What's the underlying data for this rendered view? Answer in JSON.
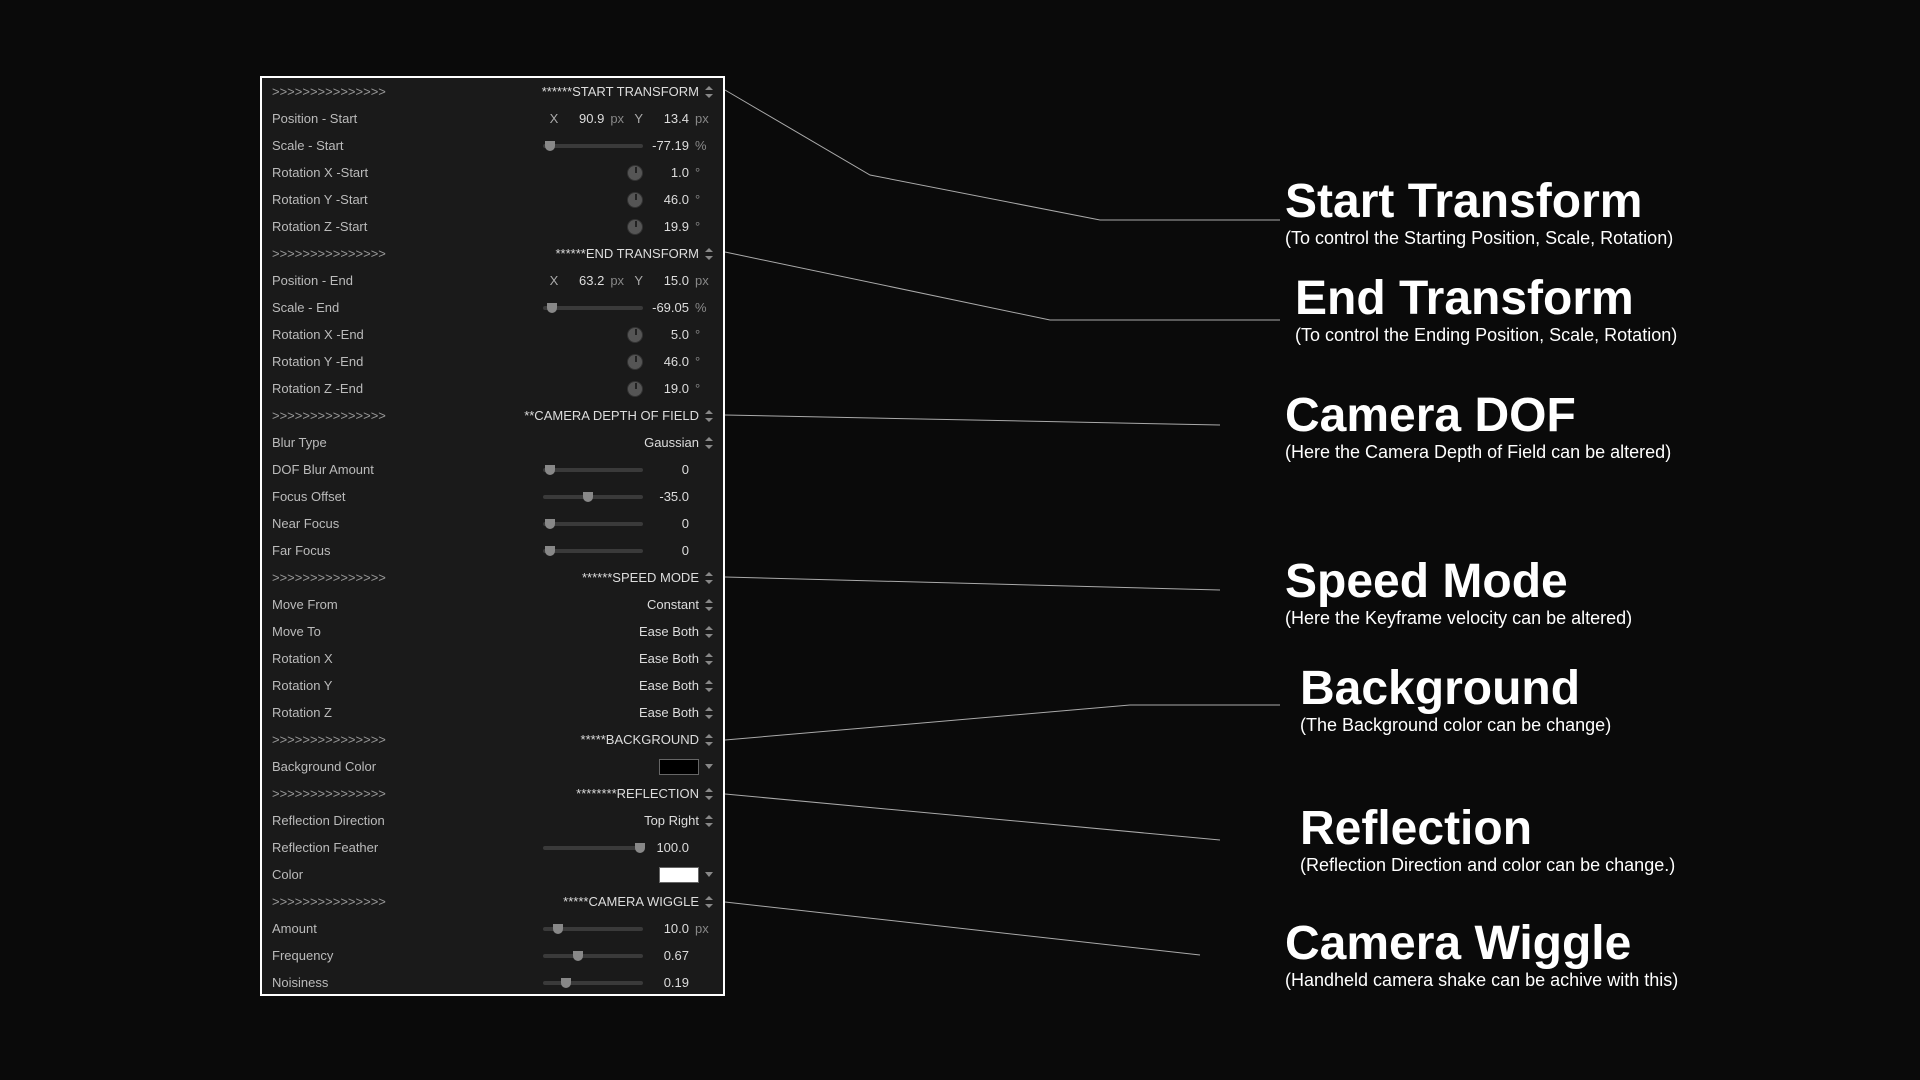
{
  "sections": {
    "start_transform": {
      "header_prefix": ">>>>>>>>>>>>>>>",
      "header": "******START TRANSFORM"
    },
    "end_transform": {
      "header_prefix": ">>>>>>>>>>>>>>>",
      "header": "******END TRANSFORM"
    },
    "dof": {
      "header_prefix": ">>>>>>>>>>>>>>>",
      "header": "**CAMERA DEPTH OF FIELD"
    },
    "speed": {
      "header_prefix": ">>>>>>>>>>>>>>>",
      "header": "******SPEED MODE"
    },
    "background": {
      "header_prefix": ">>>>>>>>>>>>>>>",
      "header": "*****BACKGROUND"
    },
    "reflection": {
      "header_prefix": ">>>>>>>>>>>>>>>",
      "header": "********REFLECTION"
    },
    "wiggle": {
      "header_prefix": ">>>>>>>>>>>>>>>",
      "header": "*****CAMERA WIGGLE"
    }
  },
  "start": {
    "position_label": "Position - Start",
    "x_axis": "X",
    "x_value": "90.9",
    "x_unit": "px",
    "y_axis": "Y",
    "y_value": "13.4",
    "y_unit": "px",
    "scale_label": "Scale - Start",
    "scale_value": "-77.19",
    "scale_unit": "%",
    "rotx_label": "Rotation X -Start",
    "rotx_value": "1.0",
    "rotx_unit": "°",
    "roty_label": "Rotation Y -Start",
    "roty_value": "46.0",
    "roty_unit": "°",
    "rotz_label": "Rotation Z -Start",
    "rotz_value": "19.9",
    "rotz_unit": "°"
  },
  "end": {
    "position_label": "Position - End",
    "x_axis": "X",
    "x_value": "63.2",
    "x_unit": "px",
    "y_axis": "Y",
    "y_value": "15.0",
    "y_unit": "px",
    "scale_label": "Scale - End",
    "scale_value": "-69.05",
    "scale_unit": "%",
    "rotx_label": "Rotation X -End",
    "rotx_value": "5.0",
    "rotx_unit": "°",
    "roty_label": "Rotation Y -End",
    "roty_value": "46.0",
    "roty_unit": "°",
    "rotz_label": "Rotation Z -End",
    "rotz_value": "19.0",
    "rotz_unit": "°"
  },
  "dof": {
    "blur_type_label": "Blur Type",
    "blur_type_value": "Gaussian",
    "blur_amount_label": "DOF Blur Amount",
    "blur_amount_value": "0",
    "focus_offset_label": "Focus Offset",
    "focus_offset_value": "-35.0",
    "near_focus_label": "Near Focus",
    "near_focus_value": "0",
    "far_focus_label": "Far Focus",
    "far_focus_value": "0"
  },
  "speed": {
    "move_from_label": "Move From",
    "move_from_value": "Constant",
    "move_to_label": "Move To",
    "move_to_value": "Ease Both",
    "rotx_label": "Rotation X",
    "rotx_value": "Ease Both",
    "roty_label": "Rotation Y",
    "roty_value": "Ease Both",
    "rotz_label": "Rotation Z",
    "rotz_value": "Ease Both"
  },
  "background": {
    "color_label": "Background Color",
    "color_value": "#000000"
  },
  "reflection": {
    "direction_label": "Reflection Direction",
    "direction_value": "Top Right",
    "feather_label": "Reflection Feather",
    "feather_value": "100.0",
    "color_label": "Color",
    "color_value": "#ffffff"
  },
  "wiggle": {
    "amount_label": "Amount",
    "amount_value": "10.0",
    "amount_unit": "px",
    "frequency_label": "Frequency",
    "frequency_value": "0.67",
    "noisiness_label": "Noisiness",
    "noisiness_value": "0.19"
  },
  "callouts": {
    "start": {
      "title": "Start Transform",
      "sub": "(To control the Starting Position, Scale, Rotation)"
    },
    "end": {
      "title": "End Transform",
      "sub": "(To control the Ending Position, Scale, Rotation)"
    },
    "dof": {
      "title": "Camera DOF",
      "sub": "(Here the Camera Depth of Field can be altered)"
    },
    "speed": {
      "title": "Speed Mode",
      "sub": "(Here the Keyframe velocity can be altered)"
    },
    "background": {
      "title": "Background",
      "sub": "(The Background color can be change)"
    },
    "reflection": {
      "title": "Reflection",
      "sub": "(Reflection Direction and color can be change.)"
    },
    "wiggle": {
      "title": "Camera Wiggle",
      "sub": "(Handheld camera shake can be achive with this)"
    }
  }
}
